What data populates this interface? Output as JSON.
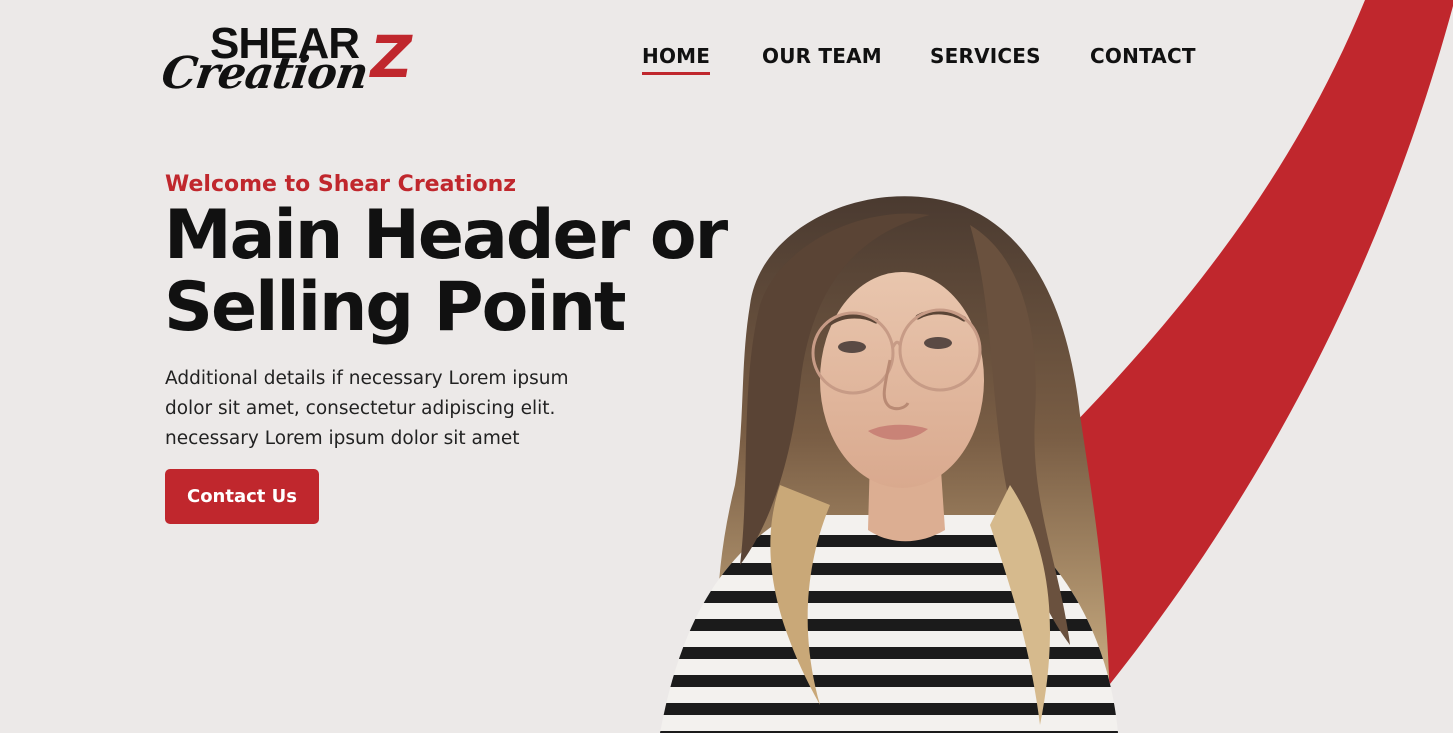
{
  "colors": {
    "background": "#ECE9E8",
    "accent": "#C0272D",
    "text": "#111111"
  },
  "logo": {
    "line1": "SHEAR",
    "line2": "Creation",
    "accent_letter": "Z"
  },
  "nav": {
    "items": [
      {
        "label": "HOME",
        "active": true
      },
      {
        "label": "OUR TEAM",
        "active": false
      },
      {
        "label": "SERVICES",
        "active": false
      },
      {
        "label": "CONTACT",
        "active": false
      }
    ]
  },
  "hero": {
    "welcome": "Welcome to Shear Creationz",
    "headline": "Main Header or Selling Point",
    "subtext": "Additional details if necessary Lorem ipsum dolor sit amet, consectetur adipiscing elit. necessary Lorem ipsum dolor sit amet",
    "cta_label": "Contact Us",
    "photo_icon": "woman-portrait-image"
  }
}
